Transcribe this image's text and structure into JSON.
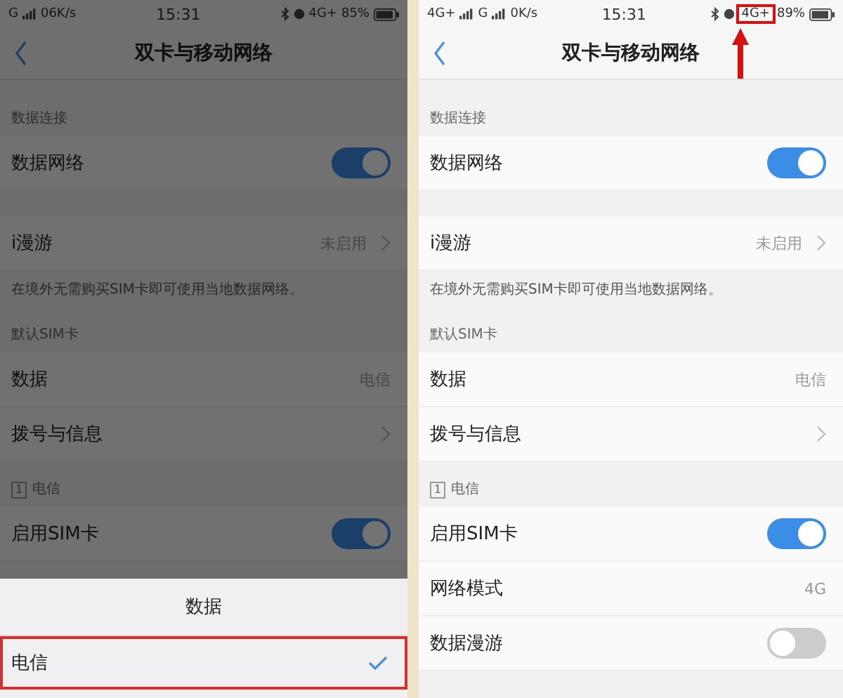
{
  "panels": [
    {
      "status_bar": {
        "signals": [
          {
            "label": "G"
          }
        ],
        "speed": "06K/s",
        "time": "15:31",
        "network": "4G+",
        "network_highlighted": false,
        "battery": "85%"
      },
      "title": "双卡与移动网络",
      "dimmed": true,
      "arrow": false,
      "sections": [
        {
          "header": "数据连接",
          "rows": [
            {
              "kind": "toggle",
              "label": "数据网络",
              "on": true
            }
          ]
        },
        {
          "rows": [
            {
              "kind": "value",
              "label": "i漫游",
              "value": "未启用",
              "chevron": true
            }
          ],
          "note": "在境外无需购买SIM卡即可使用当地数据网络。"
        },
        {
          "header": "默认SIM卡",
          "rows": [
            {
              "kind": "value",
              "label": "数据",
              "value": "电信",
              "chevron": false
            },
            {
              "kind": "value",
              "label": "拨号与信息",
              "chevron": true
            }
          ]
        },
        {
          "header": "电信",
          "sim": "1",
          "rows": [
            {
              "kind": "toggle",
              "label": "启用SIM卡",
              "on": true
            }
          ]
        }
      ],
      "sheet": {
        "title": "数据",
        "options": [
          {
            "label": "电信",
            "selected": true,
            "highlighted": true
          }
        ]
      }
    },
    {
      "status_bar": {
        "signals": [
          {
            "label": "4G+"
          },
          {
            "label": "G"
          }
        ],
        "speed": "0K/s",
        "time": "15:31",
        "network": "4G+",
        "network_highlighted": true,
        "battery": "89%"
      },
      "title": "双卡与移动网络",
      "dimmed": false,
      "arrow": true,
      "sections": [
        {
          "header": "数据连接",
          "rows": [
            {
              "kind": "toggle",
              "label": "数据网络",
              "on": true
            }
          ]
        },
        {
          "rows": [
            {
              "kind": "value",
              "label": "i漫游",
              "value": "未启用",
              "chevron": true
            }
          ],
          "note": "在境外无需购买SIM卡即可使用当地数据网络。"
        },
        {
          "header": "默认SIM卡",
          "rows": [
            {
              "kind": "value",
              "label": "数据",
              "value": "电信",
              "chevron": false
            },
            {
              "kind": "value",
              "label": "拨号与信息",
              "chevron": true
            }
          ]
        },
        {
          "header": "电信",
          "sim": "1",
          "rows": [
            {
              "kind": "toggle",
              "label": "启用SIM卡",
              "on": true
            },
            {
              "kind": "value",
              "label": "网络模式",
              "value": "4G",
              "chevron": false
            },
            {
              "kind": "toggle",
              "label": "数据漫游",
              "on": false
            }
          ]
        }
      ]
    }
  ]
}
